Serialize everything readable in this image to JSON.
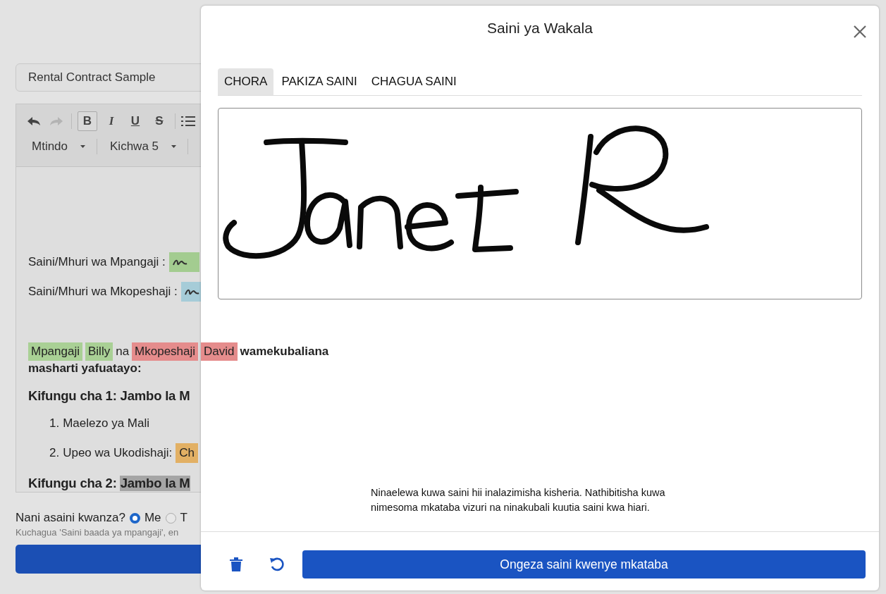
{
  "document_title": {
    "value": "Rental Contract Sample"
  },
  "toolbar": {
    "history_buttons": [
      {
        "kind": "undo",
        "disabled": false
      },
      {
        "kind": "redo",
        "disabled": true
      }
    ],
    "format_buttons": [
      {
        "label": "B",
        "kind": "bold",
        "selected": true
      },
      {
        "label": "I",
        "kind": "italic",
        "selected": false
      },
      {
        "label": "U",
        "kind": "underline",
        "selected": false
      },
      {
        "label": "S",
        "kind": "strike",
        "selected": false
      }
    ],
    "dropdowns": [
      {
        "label": "Mtindo"
      },
      {
        "label": "Kichwa 5"
      }
    ]
  },
  "document": {
    "signature_fields": [
      {
        "label": "Saini/Mhuri wa Mpangaji :",
        "color": "#a3cc90"
      },
      {
        "label": "Saini/Mhuri wa Mkopeshaji :",
        "color": "#a6ccd8"
      }
    ],
    "parties_line": [
      {
        "text": "Mpangaji",
        "color": "#a9d095"
      },
      {
        "text": "Billy",
        "color": "#a9d095"
      },
      {
        "text": "na"
      },
      {
        "text": "Mkopeshaji",
        "color": "#e58c8c"
      },
      {
        "text": "David",
        "color": "#e58c8c"
      },
      {
        "text": "wamekubaliana",
        "bold": true
      }
    ],
    "terms_line": "masharti yafuatayo:",
    "clause_1": {
      "heading": "Kifungu cha 1: Jambo la M",
      "items": [
        {
          "number": "1.",
          "text": "Maelezo ya Mali"
        },
        {
          "number": "2.",
          "text": "Upeo wa Ukodishaji:",
          "tag": "Ch",
          "color": "#e2b064"
        }
      ]
    },
    "clause_2": {
      "heading": "Kifungu cha 2:",
      "highlight": "Jambo la M"
    }
  },
  "signing_order": {
    "question": "Nani asaini kwanza?",
    "options": [
      {
        "label": "Me",
        "selected": true
      },
      {
        "label": "T",
        "selected": false
      }
    ],
    "hint": "Kuchagua 'Saini baada ya mpangaji', en"
  },
  "modal": {
    "title": "Saini ya Wakala",
    "tabs": [
      {
        "label": "CHORA",
        "selected": true
      },
      {
        "label": "PAKIZA SAINI",
        "selected": false
      },
      {
        "label": "CHAGUA SAINI",
        "selected": false
      }
    ],
    "consent": "Ninaelewa kuwa saini hii inalazimisha kisheria. Nathibitisha kuwa nimesoma mkataba vizuri na ninakubali kuutia saini kwa hiari.",
    "submit_button": "Ongeza saini kwenye mkataba"
  }
}
